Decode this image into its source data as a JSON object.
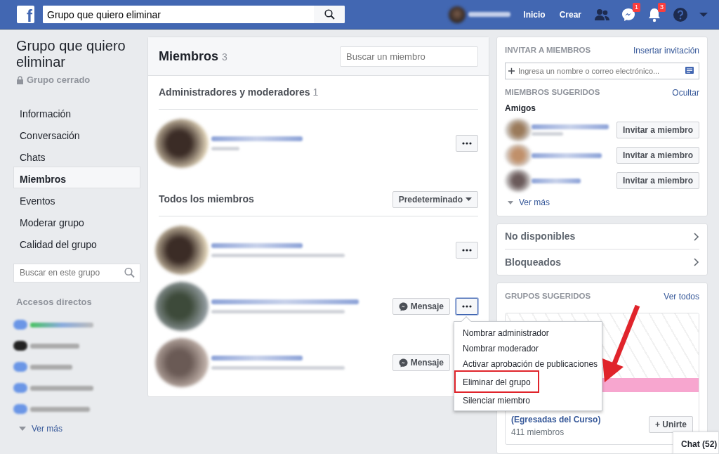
{
  "topbar": {
    "logo": "f",
    "search_value": "Grupo que quiero eliminar",
    "nav": [
      "Inicio",
      "Crear"
    ],
    "message_badge": "1",
    "notification_badge": "3"
  },
  "sidebar": {
    "group_name": "Grupo que quiero eliminar",
    "privacy": "Grupo cerrado",
    "items": [
      {
        "label": "Información",
        "selected": false
      },
      {
        "label": "Conversación",
        "selected": false
      },
      {
        "label": "Chats",
        "selected": false
      },
      {
        "label": "Miembros",
        "selected": true
      },
      {
        "label": "Eventos",
        "selected": false
      },
      {
        "label": "Moderar grupo",
        "selected": false
      },
      {
        "label": "Calidad del grupo",
        "selected": false
      }
    ],
    "search_placeholder": "Buscar en este grupo",
    "shortcuts_title": "Accesos directos",
    "see_more": "Ver más"
  },
  "members": {
    "title": "Miembros",
    "count": "3",
    "search_placeholder": "Buscar un miembro",
    "sections": [
      {
        "title": "Administradores y moderadores",
        "count": "1",
        "rows": [
          {
            "message_button": null,
            "menu_open": false
          }
        ]
      },
      {
        "title": "Todos los miembros",
        "sort": "Predeterminado",
        "rows": [
          {
            "message_button": null,
            "menu_open": false
          },
          {
            "message_button": "Mensaje",
            "menu_open": true
          },
          {
            "message_button": "Mensaje",
            "menu_open": false
          }
        ]
      }
    ],
    "context_menu": [
      {
        "label": "Nombrar administrador",
        "highlighted": false
      },
      {
        "label": "Nombrar moderador",
        "highlighted": false
      },
      {
        "label": "Activar aprobación de publicaciones",
        "highlighted": false
      },
      {
        "label": "Eliminar del grupo",
        "highlighted": true
      },
      {
        "label": "Silenciar miembro",
        "highlighted": false
      }
    ]
  },
  "invite": {
    "title": "INVITAR A MIEMBROS",
    "link": "Insertar invitación",
    "input_placeholder": "Ingresa un nombre o correo electrónico...",
    "suggested_title": "MIEMBROS SUGERIDOS",
    "hide_link": "Ocultar",
    "friends_label": "Amigos",
    "suggestions": [
      {
        "button": "Invitar a miembro"
      },
      {
        "button": "Invitar a miembro"
      },
      {
        "button": "Invitar a miembro"
      }
    ],
    "see_more": "Ver más"
  },
  "lists": [
    "No disponibles",
    "Bloqueados"
  ],
  "suggested_groups": {
    "title": "GRUPOS SUGERIDOS",
    "link": "Ver todos",
    "groups": [
      {
        "name": "(Egresadas del Curso)",
        "members": "411 miembros",
        "join": "+ Unirte"
      }
    ]
  },
  "chat": "Chat (52)"
}
